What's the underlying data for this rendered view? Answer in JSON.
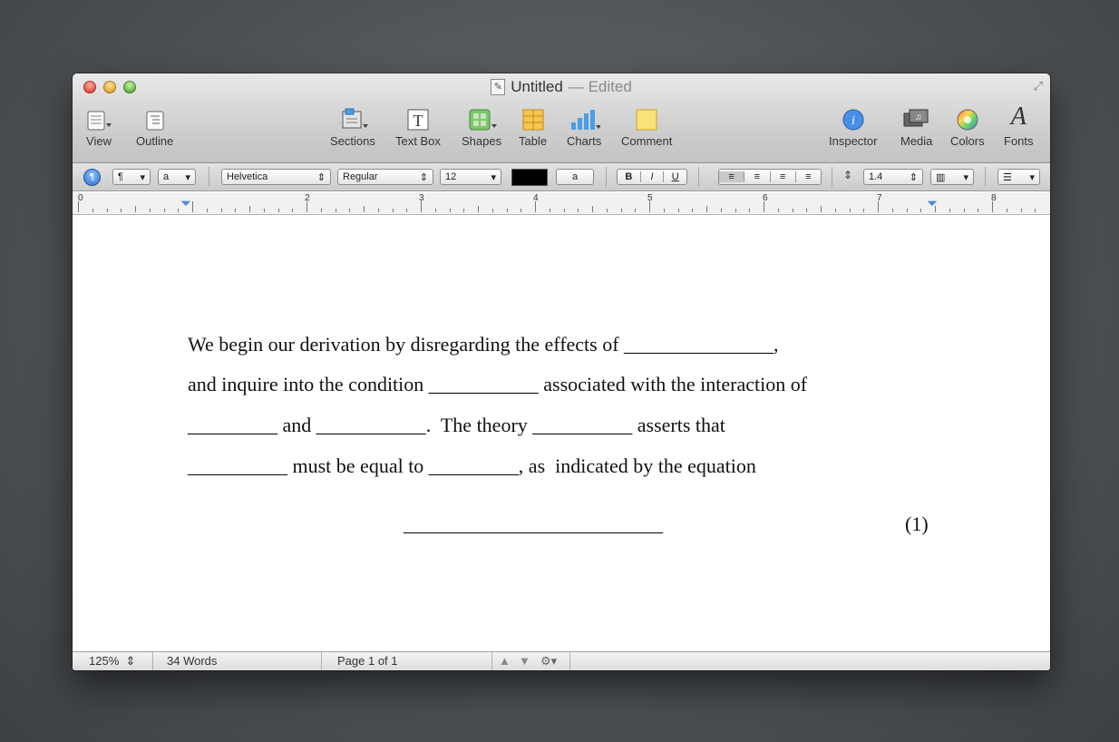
{
  "window": {
    "title": "Untitled",
    "edited": "— Edited"
  },
  "toolbar": {
    "view": "View",
    "outline": "Outline",
    "sections": "Sections",
    "textbox": "Text Box",
    "shapes": "Shapes",
    "table": "Table",
    "charts": "Charts",
    "comment": "Comment",
    "inspector": "Inspector",
    "media": "Media",
    "colors": "Colors",
    "fonts": "Fonts"
  },
  "format": {
    "paragraph": "¶",
    "char": "a",
    "font": "Helvetica",
    "style": "Regular",
    "size": "12",
    "bold": "B",
    "italic": "I",
    "underline": "U",
    "spacing": "1.4"
  },
  "ruler": {
    "numbers": [
      "0",
      "2",
      "3",
      "4",
      "5",
      "6",
      "7",
      "8"
    ]
  },
  "document": {
    "lines": [
      "We begin our derivation by disregarding the effects of _______________,",
      "and inquire into the condition ___________ associated with the interaction of",
      "_________ and ___________.  The theory __________ asserts that",
      "__________ must be equal to _________, as  indicated by the equation"
    ],
    "equation_blank": "__________________________",
    "equation_number": "(1)"
  },
  "status": {
    "zoom": "125%",
    "words": "34 Words",
    "page": "Page 1 of 1"
  },
  "colors": {
    "text_color": "#000000",
    "accent": "#3b7fd9"
  }
}
